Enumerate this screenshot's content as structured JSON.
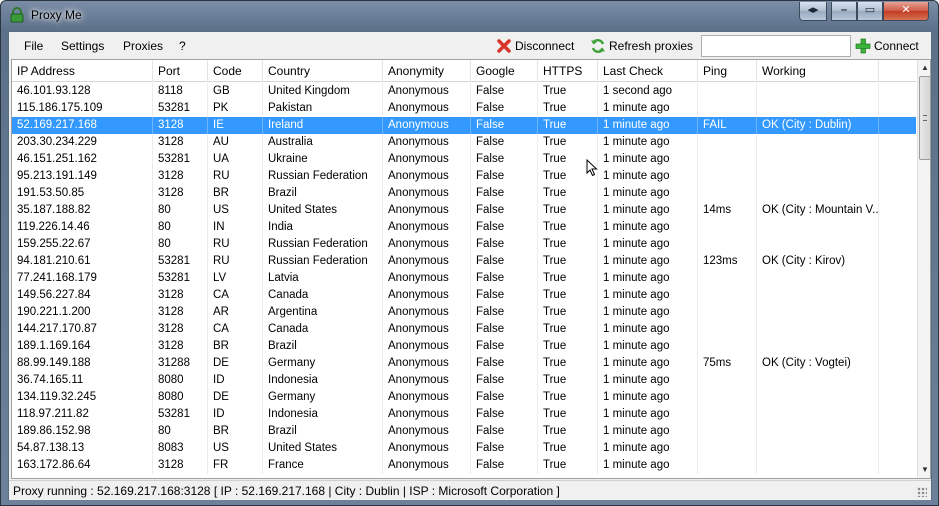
{
  "window": {
    "title": "Proxy Me"
  },
  "menu": {
    "file": "File",
    "settings": "Settings",
    "proxies": "Proxies",
    "help": "?"
  },
  "toolbar": {
    "disconnect_label": "Disconnect",
    "refresh_label": "Refresh proxies",
    "connect_label": "Connect",
    "search_value": ""
  },
  "columns": [
    "IP Address",
    "Port",
    "Code",
    "Country",
    "Anonymity",
    "Google",
    "HTTPS",
    "Last Check",
    "Ping",
    "Working"
  ],
  "rows": [
    {
      "ip": "46.101.93.128",
      "port": "8118",
      "code": "GB",
      "country": "United Kingdom",
      "anonymity": "Anonymous",
      "google": "False",
      "https": "True",
      "last_check": "1 second ago",
      "ping": "",
      "working": ""
    },
    {
      "ip": "115.186.175.109",
      "port": "53281",
      "code": "PK",
      "country": "Pakistan",
      "anonymity": "Anonymous",
      "google": "False",
      "https": "True",
      "last_check": "1 minute ago",
      "ping": "",
      "working": ""
    },
    {
      "ip": "52.169.217.168",
      "port": "3128",
      "code": "IE",
      "country": "Ireland",
      "anonymity": "Anonymous",
      "google": "False",
      "https": "True",
      "last_check": "1 minute ago",
      "ping": "FAIL",
      "working": "OK (City : Dublin)",
      "selected": true
    },
    {
      "ip": "203.30.234.229",
      "port": "3128",
      "code": "AU",
      "country": "Australia",
      "anonymity": "Anonymous",
      "google": "False",
      "https": "True",
      "last_check": "1 minute ago",
      "ping": "",
      "working": ""
    },
    {
      "ip": "46.151.251.162",
      "port": "53281",
      "code": "UA",
      "country": "Ukraine",
      "anonymity": "Anonymous",
      "google": "False",
      "https": "True",
      "last_check": "1 minute ago",
      "ping": "",
      "working": ""
    },
    {
      "ip": "95.213.191.149",
      "port": "3128",
      "code": "RU",
      "country": "Russian Federation",
      "anonymity": "Anonymous",
      "google": "False",
      "https": "True",
      "last_check": "1 minute ago",
      "ping": "",
      "working": ""
    },
    {
      "ip": "191.53.50.85",
      "port": "3128",
      "code": "BR",
      "country": "Brazil",
      "anonymity": "Anonymous",
      "google": "False",
      "https": "True",
      "last_check": "1 minute ago",
      "ping": "",
      "working": ""
    },
    {
      "ip": "35.187.188.82",
      "port": "80",
      "code": "US",
      "country": "United States",
      "anonymity": "Anonymous",
      "google": "False",
      "https": "True",
      "last_check": "1 minute ago",
      "ping": "14ms",
      "working": "OK (City : Mountain V..."
    },
    {
      "ip": "119.226.14.46",
      "port": "80",
      "code": "IN",
      "country": "India",
      "anonymity": "Anonymous",
      "google": "False",
      "https": "True",
      "last_check": "1 minute ago",
      "ping": "",
      "working": ""
    },
    {
      "ip": "159.255.22.67",
      "port": "80",
      "code": "RU",
      "country": "Russian Federation",
      "anonymity": "Anonymous",
      "google": "False",
      "https": "True",
      "last_check": "1 minute ago",
      "ping": "",
      "working": ""
    },
    {
      "ip": "94.181.210.61",
      "port": "53281",
      "code": "RU",
      "country": "Russian Federation",
      "anonymity": "Anonymous",
      "google": "False",
      "https": "True",
      "last_check": "1 minute ago",
      "ping": "123ms",
      "working": "OK (City : Kirov)"
    },
    {
      "ip": "77.241.168.179",
      "port": "53281",
      "code": "LV",
      "country": "Latvia",
      "anonymity": "Anonymous",
      "google": "False",
      "https": "True",
      "last_check": "1 minute ago",
      "ping": "",
      "working": ""
    },
    {
      "ip": "149.56.227.84",
      "port": "3128",
      "code": "CA",
      "country": "Canada",
      "anonymity": "Anonymous",
      "google": "False",
      "https": "True",
      "last_check": "1 minute ago",
      "ping": "",
      "working": ""
    },
    {
      "ip": "190.221.1.200",
      "port": "3128",
      "code": "AR",
      "country": "Argentina",
      "anonymity": "Anonymous",
      "google": "False",
      "https": "True",
      "last_check": "1 minute ago",
      "ping": "",
      "working": ""
    },
    {
      "ip": "144.217.170.87",
      "port": "3128",
      "code": "CA",
      "country": "Canada",
      "anonymity": "Anonymous",
      "google": "False",
      "https": "True",
      "last_check": "1 minute ago",
      "ping": "",
      "working": ""
    },
    {
      "ip": "189.1.169.164",
      "port": "3128",
      "code": "BR",
      "country": "Brazil",
      "anonymity": "Anonymous",
      "google": "False",
      "https": "True",
      "last_check": "1 minute ago",
      "ping": "",
      "working": ""
    },
    {
      "ip": "88.99.149.188",
      "port": "31288",
      "code": "DE",
      "country": "Germany",
      "anonymity": "Anonymous",
      "google": "False",
      "https": "True",
      "last_check": "1 minute ago",
      "ping": "75ms",
      "working": "OK (City : Vogtei)"
    },
    {
      "ip": "36.74.165.11",
      "port": "8080",
      "code": "ID",
      "country": "Indonesia",
      "anonymity": "Anonymous",
      "google": "False",
      "https": "True",
      "last_check": "1 minute ago",
      "ping": "",
      "working": ""
    },
    {
      "ip": "134.119.32.245",
      "port": "8080",
      "code": "DE",
      "country": "Germany",
      "anonymity": "Anonymous",
      "google": "False",
      "https": "True",
      "last_check": "1 minute ago",
      "ping": "",
      "working": ""
    },
    {
      "ip": "118.97.211.82",
      "port": "53281",
      "code": "ID",
      "country": "Indonesia",
      "anonymity": "Anonymous",
      "google": "False",
      "https": "True",
      "last_check": "1 minute ago",
      "ping": "",
      "working": ""
    },
    {
      "ip": "189.86.152.98",
      "port": "80",
      "code": "BR",
      "country": "Brazil",
      "anonymity": "Anonymous",
      "google": "False",
      "https": "True",
      "last_check": "1 minute ago",
      "ping": "",
      "working": ""
    },
    {
      "ip": "54.87.138.13",
      "port": "8083",
      "code": "US",
      "country": "United States",
      "anonymity": "Anonymous",
      "google": "False",
      "https": "True",
      "last_check": "1 minute ago",
      "ping": "",
      "working": ""
    },
    {
      "ip": "163.172.86.64",
      "port": "3128",
      "code": "FR",
      "country": "France",
      "anonymity": "Anonymous",
      "google": "False",
      "https": "True",
      "last_check": "1 minute ago",
      "ping": "",
      "working": ""
    }
  ],
  "status": {
    "text": "Proxy running : 52.169.217.168:3128  [ IP : 52.169.217.168 | City : Dublin | ISP : Microsoft Corporation ]"
  },
  "colors": {
    "selection": "#3399ff",
    "disconnect_icon": "#d9342b",
    "refresh_icon": "#3fa33c",
    "connect_icon": "#3bb33b",
    "title_icon": "#3a9a3a"
  },
  "icons": {
    "app": "lock-icon",
    "disconnect": "red-x-icon",
    "refresh": "refresh-arrows-icon",
    "connect": "green-plus-icon"
  }
}
